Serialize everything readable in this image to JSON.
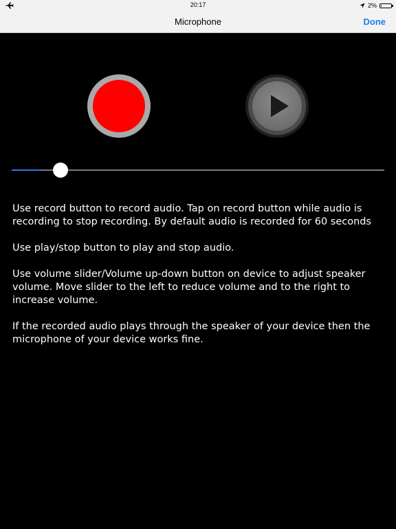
{
  "status_bar": {
    "left_icon": "airplane-icon",
    "time": "20:17",
    "location_icon": "location-arrow-icon",
    "battery_percent_label": "2%",
    "battery_level": 0.02,
    "battery_fill_color": "#d0021b"
  },
  "nav_bar": {
    "title": "Microphone",
    "done_label": "Done",
    "accent_color": "#1a7ef7"
  },
  "controls": {
    "record_icon": "record-dot-icon",
    "record_color": "#ff0000",
    "play_icon": "play-triangle-icon"
  },
  "volume_slider": {
    "value": 0.075,
    "min": 0,
    "max": 1,
    "fill_color": "#2a78e4"
  },
  "instructions": [
    "Use record button to record audio. Tap on record button while audio is recording to stop recording. By default audio is recorded for 60 seconds",
    "Use play/stop button to play and stop audio.",
    "Use volume slider/Volume up-down button on device to adjust speaker volume. Move slider to the left to reduce volume and to the right to increase volume.",
    "If the recorded audio plays through the speaker of your device then the microphone of your device works fine."
  ]
}
